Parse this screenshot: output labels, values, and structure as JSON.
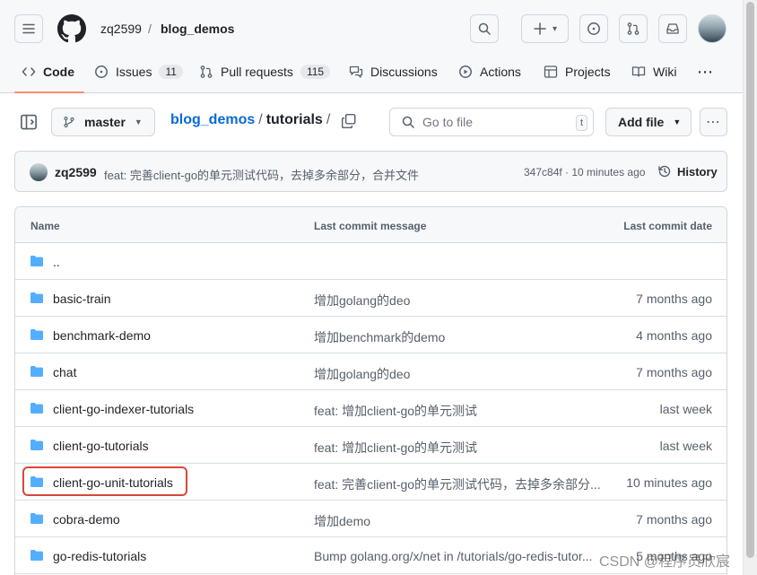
{
  "header": {
    "owner": "zq2599",
    "separator": "/",
    "repo": "blog_demos",
    "plus_caret": "▾"
  },
  "tabs": [
    {
      "label": "Code"
    },
    {
      "label": "Issues",
      "count": "11"
    },
    {
      "label": "Pull requests",
      "count": "115"
    },
    {
      "label": "Discussions"
    },
    {
      "label": "Actions"
    },
    {
      "label": "Projects"
    },
    {
      "label": "Wiki"
    },
    {
      "label": "⋯"
    }
  ],
  "filebar": {
    "branch": "master",
    "path_repo": "blog_demos",
    "path_sep": "/",
    "path_dir": "tutorials",
    "path_trailing": "/",
    "goto_placeholder": "Go to file",
    "goto_kbd": "t",
    "add_file": "Add file",
    "more": "⋯"
  },
  "commit": {
    "author": "zq2599",
    "message": "feat: 完善client-go的单元测试代码，去掉多余部分，合并文件",
    "meta": "347c84f · 10 minutes ago",
    "history": "History"
  },
  "table": {
    "headers": {
      "name": "Name",
      "message": "Last commit message",
      "date": "Last commit date"
    },
    "rows": [
      {
        "name": "..",
        "message": "",
        "date": ""
      },
      {
        "name": "basic-train",
        "message": "增加golang的deo",
        "date": "7 months ago"
      },
      {
        "name": "benchmark-demo",
        "message": "增加benchmark的demo",
        "date": "4 months ago"
      },
      {
        "name": "chat",
        "message": "增加golang的deo",
        "date": "7 months ago"
      },
      {
        "name": "client-go-indexer-tutorials",
        "message": "feat: 增加client-go的单元测试",
        "date": "last week"
      },
      {
        "name": "client-go-tutorials",
        "message": "feat: 增加client-go的单元测试",
        "date": "last week"
      },
      {
        "name": "client-go-unit-tutorials",
        "message": "feat: 完善client-go的单元测试代码，去掉多余部分...",
        "date": "10 minutes ago",
        "highlighted": true
      },
      {
        "name": "cobra-demo",
        "message": "增加demo",
        "date": "7 months ago"
      },
      {
        "name": "go-redis-tutorials",
        "message": "Bump golang.org/x/net in /tutorials/go-redis-tutor...",
        "date": "5 months ago"
      }
    ]
  },
  "watermark": "CSDN @程序员欣宸",
  "colors": {
    "accent_underline": "#fd8c73",
    "link": "#0969da",
    "folder": "#54aeff",
    "highlight_box": "#d9463b"
  }
}
